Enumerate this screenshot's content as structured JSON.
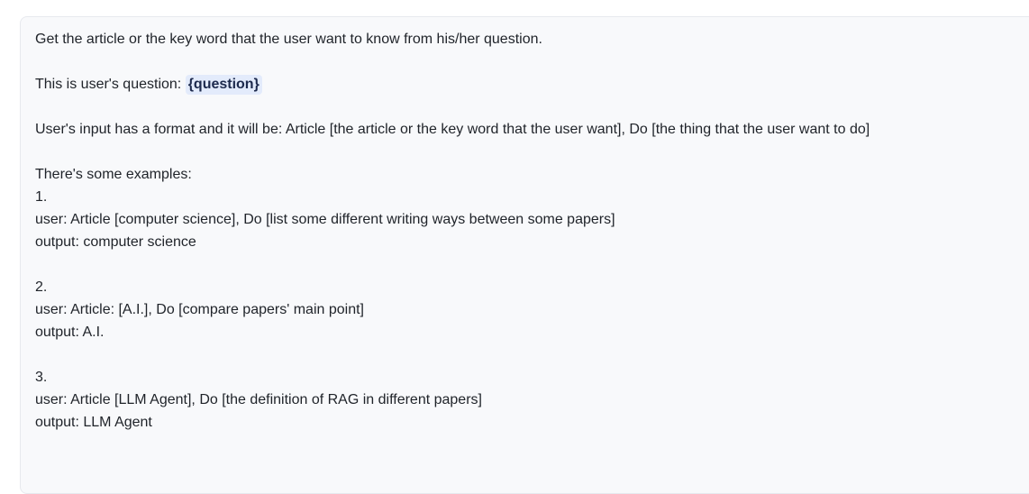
{
  "prompt": {
    "line_1": "Get the article or the key word that the user want to know from his/her question.",
    "line_2_prefix": "This is user's question: ",
    "line_2_variable": "{question}",
    "line_3": "User's input has a format and it will be: Article [the article or the key word that the user want], Do [the thing that the user want to do]",
    "examples_heading": "There's some examples:",
    "examples": [
      {
        "number": "1.",
        "user": "user: Article [computer science], Do [list some different writing ways between some papers]",
        "output": "output: computer science"
      },
      {
        "number": "2.",
        "user": "user: Article: [A.I.], Do [compare papers' main point]",
        "output": "output: A.I."
      },
      {
        "number": "3.",
        "user": "user: Article [LLM Agent], Do [the definition of RAG in different papers]",
        "output": "output: LLM Agent"
      }
    ]
  },
  "colors": {
    "panel_background": "#f8f9fb",
    "text": "#1f2329",
    "variable_chip_background": "#e3ebfb"
  }
}
